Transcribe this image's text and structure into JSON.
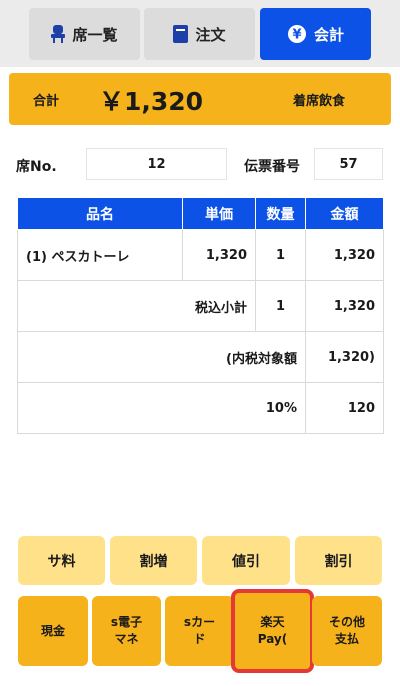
{
  "tabs": [
    {
      "label": "席一覧",
      "icon": "chair-icon"
    },
    {
      "label": "注文",
      "icon": "order-book-icon"
    },
    {
      "label": "会計",
      "icon": "yen-circle-icon",
      "active": true
    }
  ],
  "total": {
    "label": "合計",
    "amount": "￥1,320",
    "mode": "着席飲食"
  },
  "seat": {
    "label": "席No.",
    "value": "12"
  },
  "slip": {
    "label": "伝票番号",
    "value": "57"
  },
  "table": {
    "headers": [
      "品名",
      "単価",
      "数量",
      "金額"
    ],
    "item": {
      "name": "(1) ペスカトーレ",
      "price": "1,320",
      "qty": "1",
      "amount": "1,320"
    },
    "subtotal": {
      "label": "税込小計",
      "qty": "1",
      "amount": "1,320"
    },
    "taxable": {
      "label": "(内税対象額",
      "amount": "1,320)"
    },
    "tax": {
      "rate": "10%",
      "amount": "120"
    }
  },
  "adjust_buttons": [
    "サ料",
    "割増",
    "値引",
    "割引"
  ],
  "pay_buttons": [
    "現金",
    "s電子\nマネ",
    "sカー\nド",
    "楽天\nPay(",
    "その他\n支払"
  ],
  "colors": {
    "accent": "#0d52e6",
    "amber": "#f5b21a",
    "light_amber": "#ffe18a",
    "highlight": "#e53935"
  }
}
